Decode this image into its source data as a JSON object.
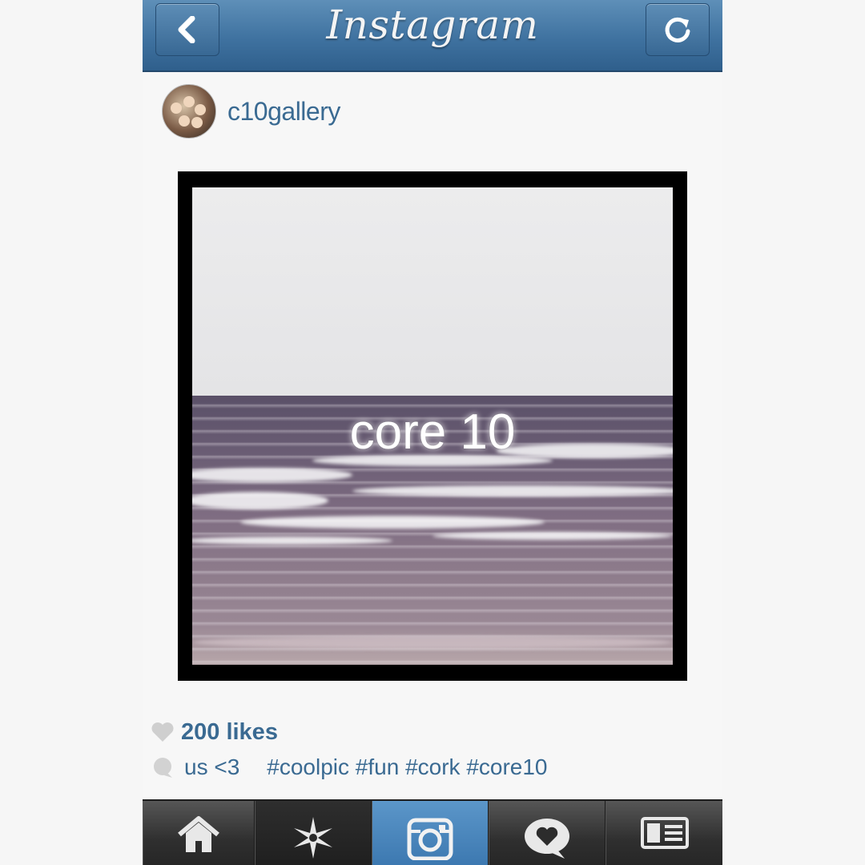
{
  "header": {
    "title": "Instagram",
    "back_icon": "chevron-left-icon",
    "refresh_icon": "refresh-icon"
  },
  "post": {
    "username": "c10gallery",
    "photo_overlay_text": "core 10",
    "likes": "200 likes",
    "caption_user": "us <3",
    "caption_tags": "#coolpic #fun #cork #core10"
  },
  "tabbar": {
    "items": [
      {
        "icon": "home-icon",
        "active": false
      },
      {
        "icon": "explore-star-icon",
        "active": false
      },
      {
        "icon": "camera-icon",
        "active": true
      },
      {
        "icon": "activity-heart-bubble-icon",
        "active": false
      },
      {
        "icon": "profile-card-icon",
        "active": false
      }
    ]
  },
  "colors": {
    "header_blue": "#3f72a0",
    "link_blue": "#3a6a92",
    "tab_active": "#4a86bd",
    "tabbar_dark": "#2f2f2f"
  }
}
